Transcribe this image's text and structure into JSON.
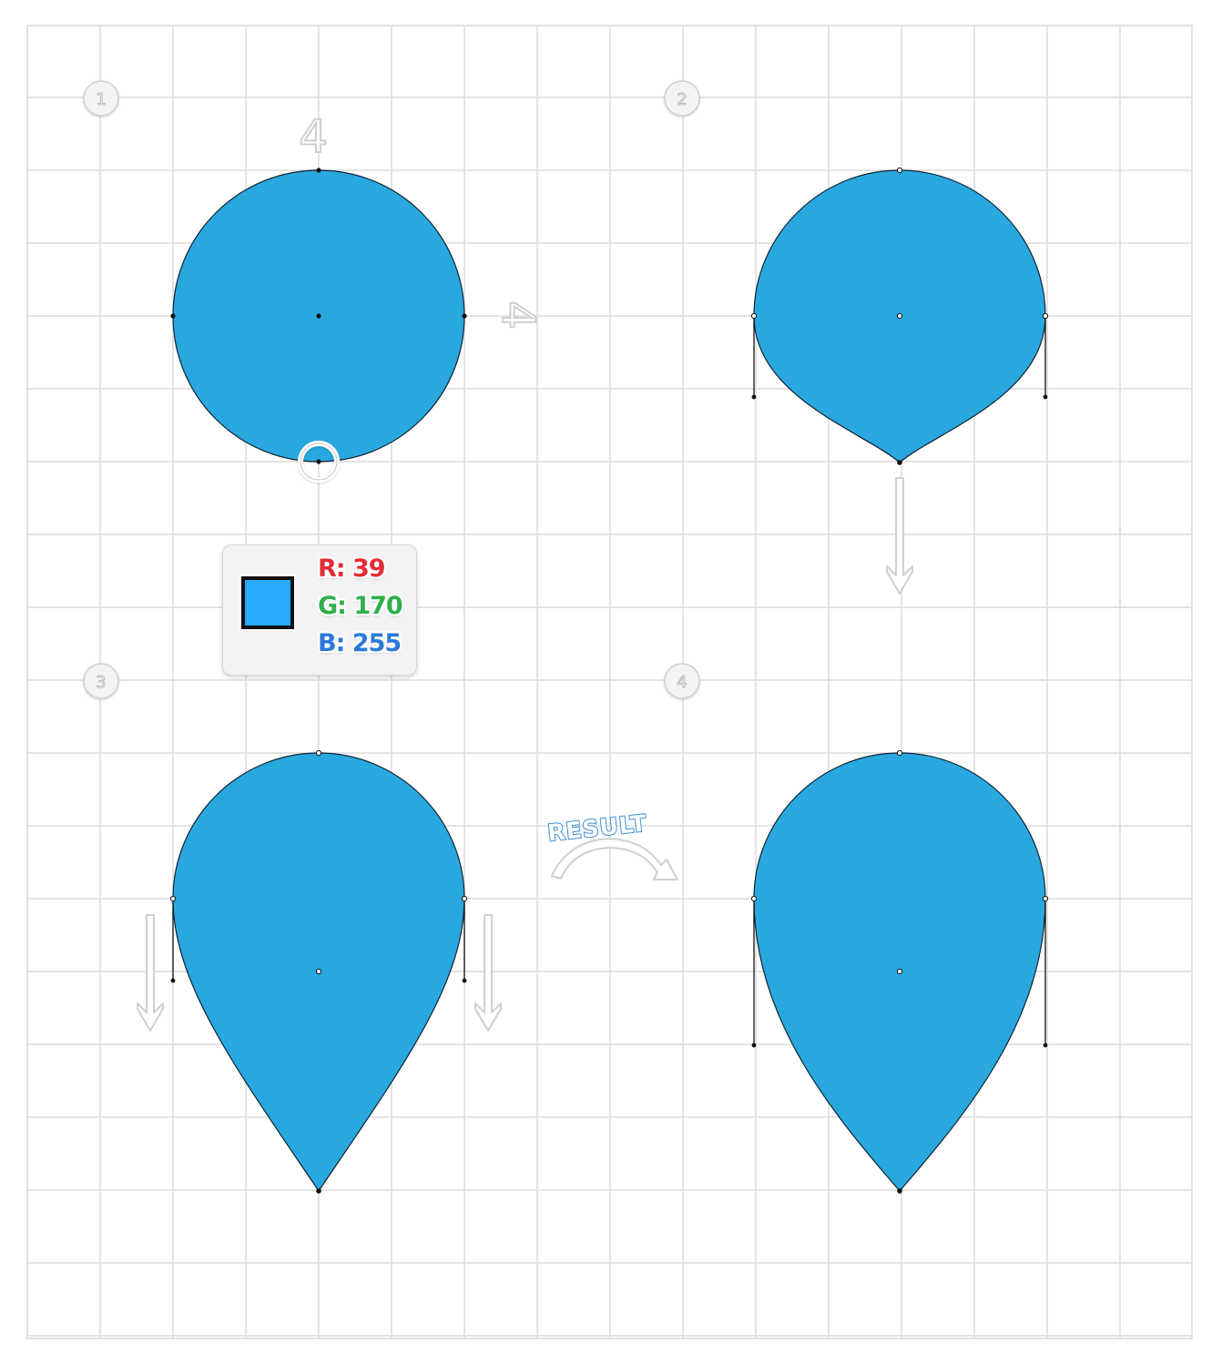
{
  "steps": {
    "s1": "1",
    "s2": "2",
    "s3": "3",
    "s4": "4"
  },
  "dimensions": {
    "top": "4",
    "side": "4"
  },
  "color": {
    "fill_hex": "#27aaff",
    "r_label": "R: 39",
    "g_label": "G: 170",
    "b_label": "B: 255"
  },
  "result_label": "RESULT",
  "colors": {
    "shape_fill": "#29a8df",
    "grid_line": "#dcdcdc",
    "arrow_outline": "#cfcfcf",
    "result_text_stroke": "#3d8fd6"
  }
}
